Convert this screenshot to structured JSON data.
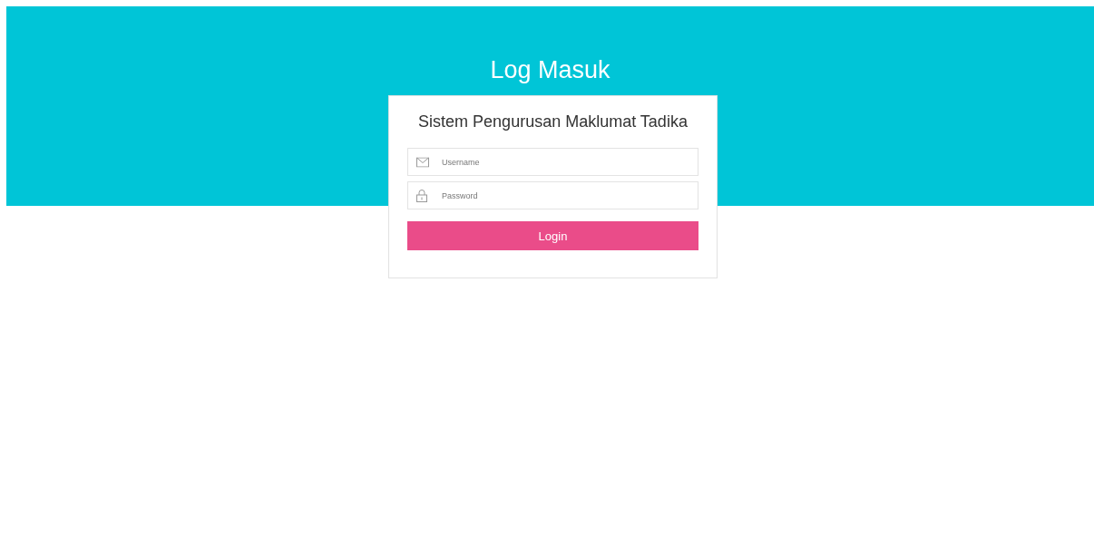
{
  "banner": {
    "title": "Log Masuk"
  },
  "card": {
    "title": "Sistem Pengurusan Maklumat Tadika",
    "fields": [
      {
        "kind": "email",
        "placeholder": "Username"
      },
      {
        "kind": "lock",
        "placeholder": "Password"
      }
    ],
    "button": "Login"
  }
}
